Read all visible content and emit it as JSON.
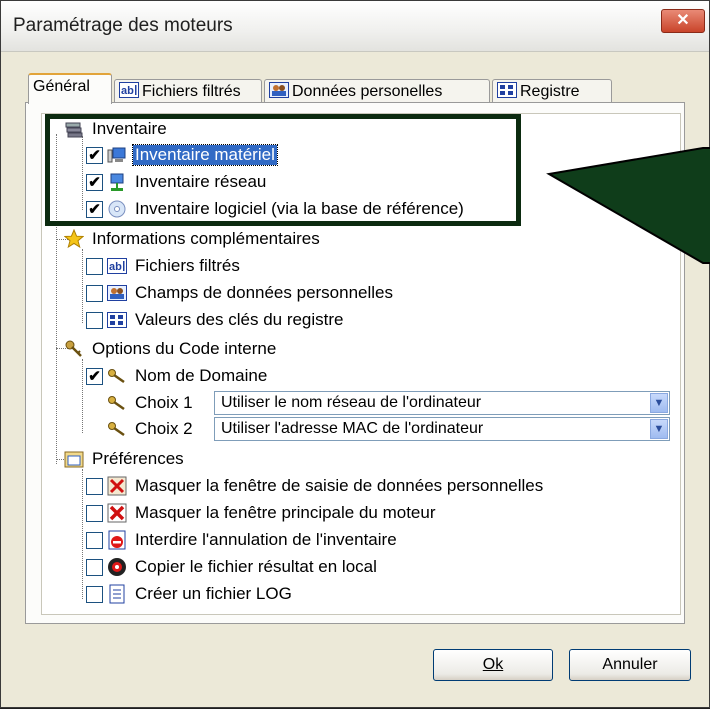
{
  "window": {
    "title": "Paramétrage des moteurs",
    "close_glyph": "✕"
  },
  "tabs": [
    {
      "label": "Général",
      "icon": "none",
      "active": true
    },
    {
      "label": "Fichiers filtrés",
      "icon": "ab-text-icon"
    },
    {
      "label": "Données personelles",
      "icon": "people-icon"
    },
    {
      "label": "Registre",
      "icon": "registry-icon"
    }
  ],
  "tree": {
    "inventaire": {
      "label": "Inventaire",
      "items": [
        {
          "label": "Inventaire matériel",
          "checked": true,
          "selected": true
        },
        {
          "label": "Inventaire réseau",
          "checked": true
        },
        {
          "label": "Inventaire logiciel (via la base de référence)",
          "checked": true
        }
      ]
    },
    "infos": {
      "label": "Informations complémentaires",
      "items": [
        {
          "label": "Fichiers filtrés",
          "checked": false
        },
        {
          "label": "Champs de données personnelles",
          "checked": false
        },
        {
          "label": "Valeurs des clés du registre",
          "checked": false
        }
      ]
    },
    "options": {
      "label": "Options du Code interne",
      "nom_domaine": {
        "label": "Nom de Domaine",
        "checked": true
      },
      "choix1": {
        "label": "Choix 1",
        "value": "Utiliser le nom réseau de l'ordinateur"
      },
      "choix2": {
        "label": "Choix 2",
        "value": "Utiliser l'adresse MAC de l'ordinateur"
      }
    },
    "preferences": {
      "label": "Préférences",
      "items": [
        {
          "label": "Masquer la fenêtre de saisie de données personnelles",
          "checked": false
        },
        {
          "label": "Masquer la fenêtre principale du moteur",
          "checked": false
        },
        {
          "label": "Interdire l'annulation de l'inventaire",
          "checked": false
        },
        {
          "label": "Copier le fichier résultat en local",
          "checked": false
        },
        {
          "label": "Créer un fichier LOG",
          "checked": false
        }
      ]
    }
  },
  "buttons": {
    "ok": "Ok",
    "cancel": "Annuler"
  },
  "glyphs": {
    "check": "✔",
    "dropdown": "▼"
  },
  "colors": {
    "selection": "#316ac5",
    "highlight_frame": "#0c2b10",
    "callout_fill": "#0f3d1a"
  }
}
